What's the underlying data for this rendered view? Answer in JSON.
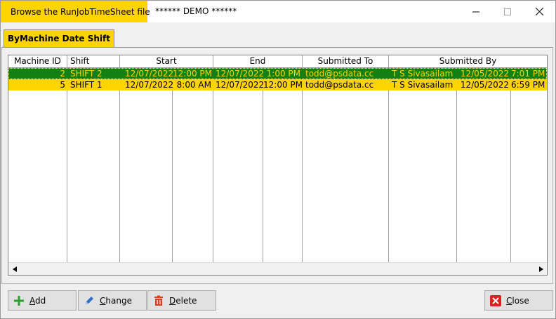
{
  "window": {
    "app_title": "Browse the RunJobTimeSheet file",
    "demo_label": "****** DEMO ******",
    "minimize_glyph": "—",
    "maximize_glyph": "☐",
    "close_glyph": "✕"
  },
  "tab": {
    "label": "ByMachine Date Shift"
  },
  "columns": [
    "Machine ID",
    "Shift",
    "Start",
    "End",
    "Submitted To",
    "Submitted By"
  ],
  "rows": [
    {
      "machine_id": "2",
      "shift": "SHIFT 2",
      "start_date": "12/07/2022",
      "start_time": "12:00 PM",
      "end_date": "12/07/2022",
      "end_time": "1:00 PM",
      "submitted_to": "todd@psdata.cc",
      "submitted_by": "T S Sivasailam",
      "submitted_date": "12/05/2022",
      "submitted_time": "7:01 PM",
      "selected": true
    },
    {
      "machine_id": "5",
      "shift": "SHIFT 1",
      "start_date": "12/07/2022",
      "start_time": "8:00 AM",
      "end_date": "12/07/2022",
      "end_time": "12:00 PM",
      "submitted_to": "todd@psdata.cc",
      "submitted_by": "T S Sivasailam",
      "submitted_date": "12/05/2022",
      "submitted_time": "6:59 PM",
      "selected": false
    }
  ],
  "buttons": {
    "add": {
      "mnemonic": "A",
      "rest": "dd"
    },
    "change": {
      "mnemonic": "C",
      "rest": "hange"
    },
    "delete": {
      "mnemonic": "D",
      "rest": "elete"
    },
    "close": {
      "mnemonic": "C",
      "rest": "lose"
    }
  },
  "colors": {
    "accent_yellow": "#ffd400",
    "selected_row_bg": "#128012",
    "add_icon": "#2e9e2e",
    "change_icon": "#2f6fc4",
    "delete_icon": "#d8401e",
    "close_icon": "#e02020"
  }
}
